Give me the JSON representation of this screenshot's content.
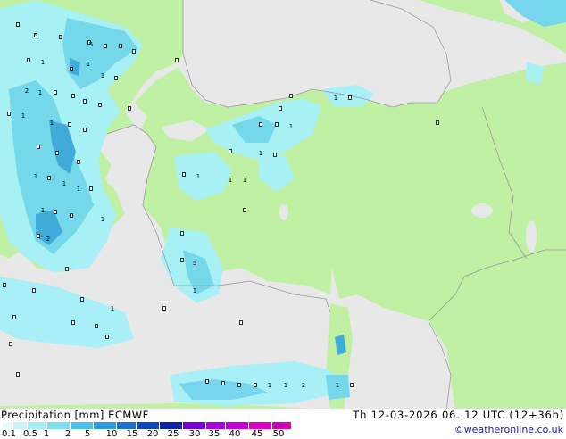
{
  "map": {
    "colors": {
      "sea": "#e8e8e8",
      "land": "#bff0a4",
      "coast": "#9a9a9a",
      "precip_light": "#a6f0f8",
      "precip_mid": "#72d6ee",
      "precip_heavy": "#3aa8dc"
    },
    "values": [
      "0",
      "0",
      "0",
      "0",
      "0",
      "0",
      "0",
      "5",
      "0",
      "1",
      "0",
      "1",
      "1",
      "0",
      "2",
      "1",
      "0",
      "0",
      "0",
      "0",
      "0",
      "0",
      "1",
      "1",
      "0",
      "0",
      "0",
      "0",
      "0",
      "1",
      "0",
      "1",
      "1",
      "0",
      "1",
      "0",
      "0",
      "1",
      "0",
      "2",
      "0",
      "0",
      "0",
      "1",
      "1",
      "1",
      "0",
      "0",
      "5",
      "0",
      "1",
      "0",
      "0",
      "1",
      "0",
      "0",
      "0",
      "0",
      "0",
      "0",
      "0",
      "0",
      "0",
      "0",
      "0",
      "1",
      "0",
      "0",
      "0",
      "1",
      "1",
      "0",
      "0",
      "0",
      "0",
      "0",
      "0",
      "0",
      "1",
      "1",
      "2",
      "1",
      "0",
      "0",
      "5",
      "1"
    ],
    "point_icon": "circle-marker-icon"
  },
  "footer": {
    "title": "Precipitation [mm]  ECMWF",
    "valid_time": "Th 12-03-2026 06..12 UTC (12+36h)",
    "credit": "©weatheronline.co.uk",
    "scale_labels": [
      "0.1",
      "0.5",
      "1",
      "2",
      "5",
      "10",
      "15",
      "20",
      "25",
      "30",
      "35",
      "40",
      "45",
      "50"
    ],
    "scale_colors": [
      "#e6fbfc",
      "#c8f4fa",
      "#a6ecf6",
      "#7cdcf0",
      "#4cc4ea",
      "#2c9ee0",
      "#1a70d0",
      "#1048c0",
      "#0a28a8",
      "#7800d8",
      "#a800e0",
      "#c800d8",
      "#e000c8",
      "#f000a8"
    ]
  }
}
